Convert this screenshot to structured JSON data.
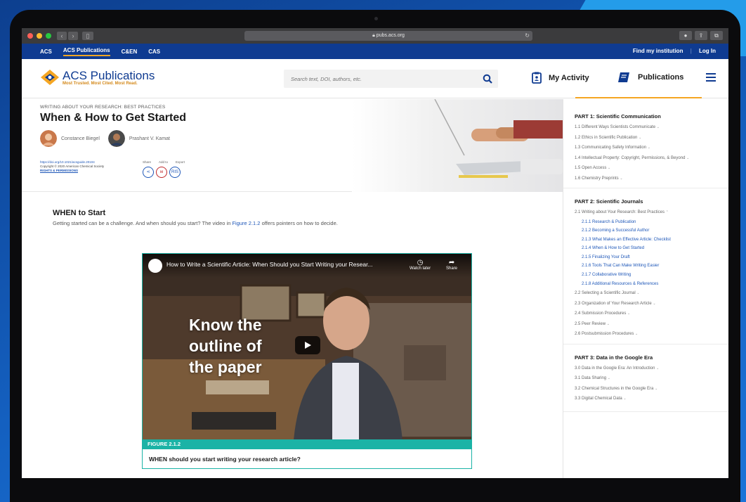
{
  "browser": {
    "url": "pubs.acs.org"
  },
  "topnav": {
    "links": [
      "ACS",
      "ACS Publications",
      "C&EN",
      "CAS"
    ],
    "find_institution": "Find my institution",
    "login": "Log In"
  },
  "header": {
    "logo_title": "ACS Publications",
    "logo_tagline": "Most Trusted. Most Cited. Most Read.",
    "search_placeholder": "Search text, DOI, authors, etc.",
    "my_activity": "My Activity",
    "publications": "Publications"
  },
  "article": {
    "kicker": "WRITING ABOUT YOUR RESEARCH: BEST PRACTICES",
    "title": "When & How to Get Started",
    "authors": [
      "Constance Biegel",
      "Prashant V. Kamat"
    ],
    "doi": "https://doi.org/10.1021/acsguide.20104",
    "copyright": "Copyright © 2020 American Chemical Society",
    "rights": "RIGHTS & PERMISSIONS",
    "share_labels": [
      "Share",
      "Add to",
      "Export"
    ],
    "export_label": "RIS"
  },
  "section": {
    "heading": "WHEN to Start",
    "text_before": "Getting started can be a challenge. And when should you start? The video in ",
    "link": "Figure 2.1.2",
    "text_after": " offers pointers on how to decide."
  },
  "video": {
    "title": "How to Write a Scientific Article: When Should you Start Writing your Resear...",
    "watch_later": "Watch later",
    "share": "Share",
    "overlay_lines": [
      "Know the",
      "outline of",
      "the paper"
    ],
    "figure_label": "FIGURE 2.1.2",
    "caption": "WHEN should you start writing your research article?"
  },
  "sidebar": {
    "parts": [
      {
        "title": "PART 1: Scientific Communication",
        "items": [
          "1.1  Different Ways Scientists Communicate",
          "1.2  Ethics in Scientific Publication",
          "1.3  Communicating Safety Information",
          "1.4  Intellectual Property: Copyright, Permissions, & Beyond",
          "1.5  Open Access",
          "1.6  Chemistry Preprints"
        ]
      },
      {
        "title": "PART 2: Scientific Journals",
        "items_before": [
          "2.1  Writing about Your Research: Best Practices"
        ],
        "subitems": [
          "2.1.1   Research & Publication",
          "2.1.2   Becoming a Successful Author",
          "2.1.3   What Makes an Effective Article: Checklist",
          "2.1.4   When & How to Get Started",
          "2.1.5   Finalizing Your Draft",
          "2.1.6   Tools That Can Make Writing Easier",
          "2.1.7   Collaborative Writing",
          "2.1.8   Additional Resources & References"
        ],
        "items": [
          "2.2  Selecting a Scientific Journal",
          "2.3  Organization of Your Research Article",
          "2.4  Submission Procedures",
          "2.5  Peer Review",
          "2.6  Postsubmission Procedures"
        ]
      },
      {
        "title": "PART 3: Data in the Google Era",
        "items": [
          "3.0  Data in the Google Era: An Introduction",
          "3.1  Data Sharing",
          "3.2  Chemical Structures in the Google Era",
          "3.3  Digital Chemical Data"
        ]
      }
    ]
  },
  "colors": {
    "brand_blue": "#0f3b91",
    "accent_orange": "#f5a623",
    "teal": "#1bb3a6",
    "link_blue": "#1e57b8"
  }
}
